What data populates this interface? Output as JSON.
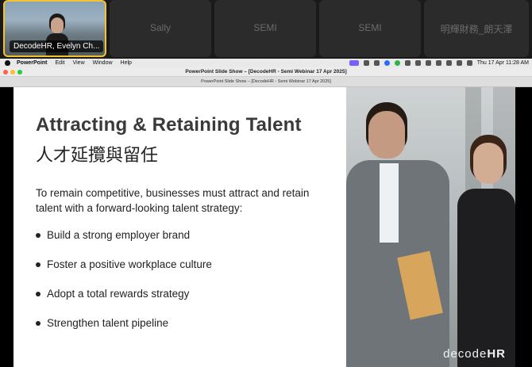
{
  "participants": [
    {
      "name": "DecodeHR, Evelyn Ch...",
      "video": true
    },
    {
      "name": "Sally",
      "video": false
    },
    {
      "name": "SEMI",
      "video": false
    },
    {
      "name": "SEMI",
      "video": false
    },
    {
      "name": "明輝財務_朗天澤",
      "video": false
    }
  ],
  "menubar": {
    "app": "PowerPoint",
    "items": [
      "Edit",
      "View",
      "Window",
      "Help"
    ],
    "clock": "Thu 17 Apr  11:28 AM"
  },
  "window": {
    "title": "PowerPoint Slide Show – [DecodeHR - Semi Webinar 17 Apr 2025]",
    "tab": "PowerPoint Slide Show – [DecodeHR - Semi Webinar 17 Apr 2025]"
  },
  "slide": {
    "title": "Attracting & Retaining Talent",
    "title_zh": "人才延攬與留任",
    "intro": "To remain competitive, businesses must attract and retain talent with a forward-looking talent strategy:",
    "bullets": [
      "Build a strong employer brand",
      "Foster a positive workplace culture",
      "Adopt a total rewards strategy",
      "Strengthen talent pipeline"
    ],
    "logo_prefix": "decode",
    "logo_suffix": "HR"
  },
  "colors": {
    "video_highlight": "#f2c230",
    "slide_title": "#3a3a3a",
    "menubar_accent": "#7a5cff"
  }
}
